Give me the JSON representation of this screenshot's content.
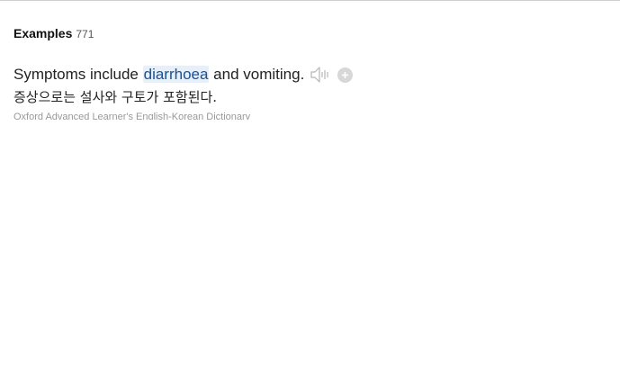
{
  "section": {
    "title": "Examples",
    "count": "771"
  },
  "example": {
    "sentence_before": "Symptoms include ",
    "sentence_highlight": "diarrhoea",
    "sentence_after": " and vomiting.",
    "translation": "증상으로는 설사와 구토가 포함된다.",
    "source": "Oxford Advanced Learner's English-Korean Dictionary"
  },
  "icons": {
    "speaker": "speaker-icon",
    "add": "plus-icon"
  },
  "colors": {
    "highlight_bg": "#e6f0fa",
    "highlight_text": "#1d4f91",
    "icon_gray": "#bdbdbd"
  }
}
